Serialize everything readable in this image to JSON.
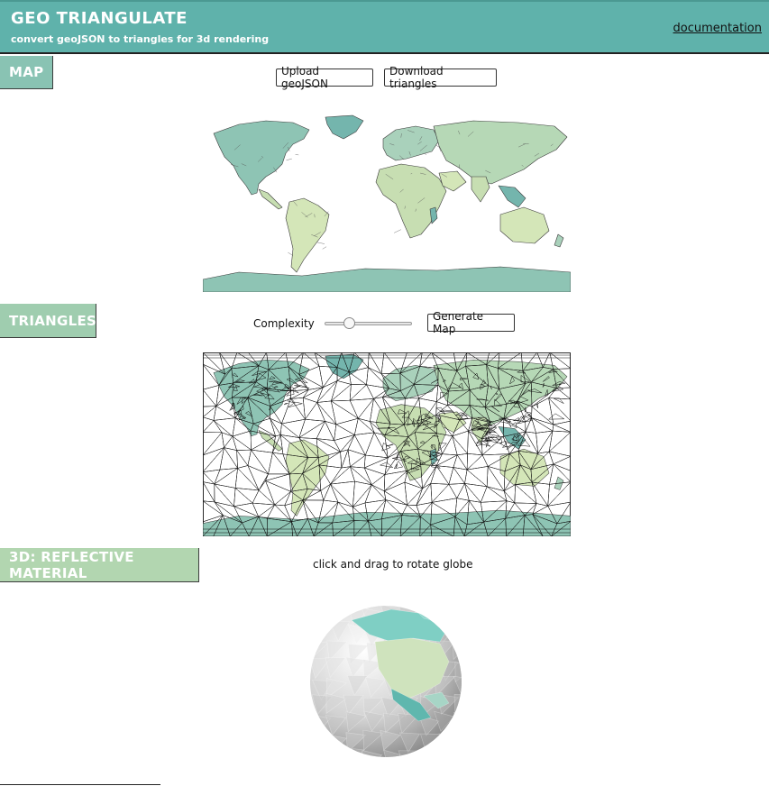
{
  "header": {
    "title": "GEO TRIANGULATE",
    "subtitle": "convert geoJSON to triangles for 3d rendering",
    "doc_link": "documentation"
  },
  "sections": {
    "map": {
      "label": "MAP",
      "color": "#89c3b3"
    },
    "triangles": {
      "label": "TRIANGLES",
      "color": "#9fcdaf"
    },
    "globe": {
      "label": "3D: REFLECTIVE MATERIAL",
      "color": "#b2d6b0"
    }
  },
  "map_controls": {
    "upload_label": "Upload geoJSON",
    "download_label": "Download triangles"
  },
  "triangle_controls": {
    "complexity_label": "Complexity",
    "complexity_value": 0.25,
    "generate_label": "Generate Map"
  },
  "globe_hint": "click and drag to rotate globe",
  "palette": {
    "teal": "#5fb2ab",
    "land": [
      "#8ec4b4",
      "#c7deb2",
      "#a9d1bb",
      "#d4e6b8",
      "#74b5ad",
      "#b6d8b6"
    ],
    "ocean_strip": "#7fbfb2"
  }
}
